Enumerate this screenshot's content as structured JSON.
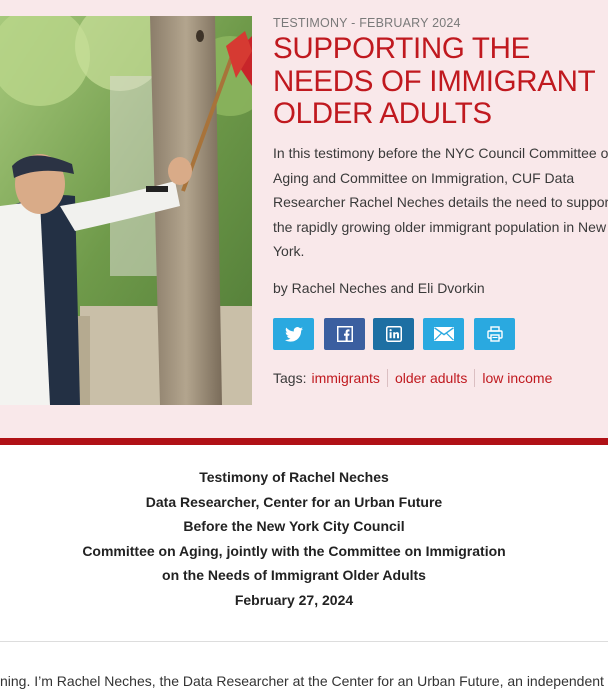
{
  "hero": {
    "meta": "TESTIMONY - FEBRUARY 2024",
    "title": "SUPPORTING THE NEEDS OF IMMIGRANT OLDER ADULTS",
    "summary": "In this testimony before the NYC Council Committee on Aging and Committee on Immigration, CUF Data Researcher Rachel Neches details the need to support the rapidly growing older immigrant population in New York.",
    "authors": "by Rachel Neches and Eli Dvorkin",
    "share": [
      {
        "icon": "twitter-icon",
        "color": "#2aa9e0"
      },
      {
        "icon": "facebook-icon",
        "color": "#3b5fa0"
      },
      {
        "icon": "linkedin-icon",
        "color": "#1d6fa3"
      },
      {
        "icon": "email-icon",
        "color": "#2aa9e0"
      },
      {
        "icon": "print-icon",
        "color": "#2aa9e0"
      }
    ],
    "tags_label": "Tags:",
    "tags": [
      "immigrants",
      "older adults",
      "low income"
    ]
  },
  "testimony_header": {
    "line1": "Testimony of Rachel Neches",
    "line2": "Data Researcher, Center for an Urban Future",
    "line3": "Before the New York City Council",
    "line4": "Committee on Aging, jointly with the Committee on Immigration",
    "line5": "on the Needs of Immigrant Older Adults",
    "line6": "February 27, 2024"
  },
  "body": {
    "first_line": "ning. I’m Rachel Neches, the Data Researcher at the Center for an Urban Future, an independent"
  },
  "colors": {
    "accent": "#c0191f",
    "hero_background": "#f9e8ea",
    "divider": "#b01116"
  }
}
